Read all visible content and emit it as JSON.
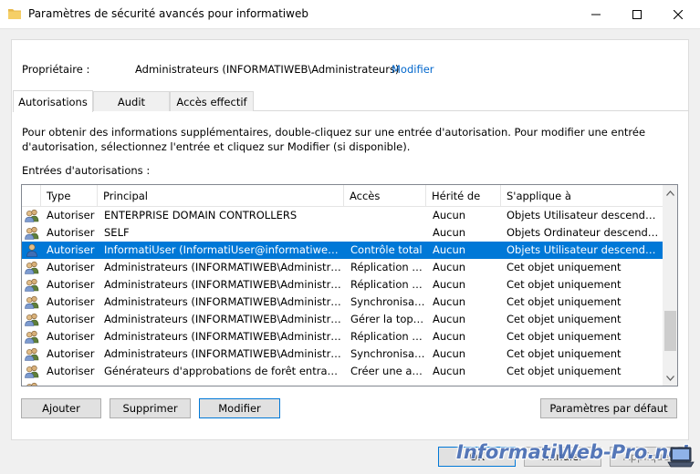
{
  "window": {
    "title": "Paramètres de sécurité avancés pour informatiweb",
    "icon": "folder-icon",
    "controls": [
      "minimize-icon",
      "maximize-icon",
      "close-icon"
    ]
  },
  "owner": {
    "label": "Propriétaire :",
    "value": "Administrateurs (INFORMATIWEB\\Administrateurs)",
    "change_link": "Modifier"
  },
  "tabs": [
    {
      "label": "Autorisations",
      "active": true
    },
    {
      "label": "Audit",
      "active": false
    },
    {
      "label": "Accès effectif",
      "active": false
    }
  ],
  "info_text": "Pour obtenir des informations supplémentaires, double-cliquez sur une entrée d'autorisation. Pour modifier une entrée d'autorisation, sélectionnez l'entrée et cliquez sur Modifier (si disponible).",
  "entries_label": "Entrées d'autorisations :",
  "table": {
    "columns": [
      "Type",
      "Principal",
      "Accès",
      "Hérité de",
      "S'applique à"
    ],
    "rows": [
      {
        "icon": "group-icon",
        "type": "Autoriser",
        "principal": "ENTERPRISE DOMAIN CONTROLLERS",
        "access": "",
        "inherited": "Aucun",
        "applies": "Objets Utilisateur descendants",
        "selected": false
      },
      {
        "icon": "group-icon",
        "type": "Autoriser",
        "principal": "SELF",
        "access": "",
        "inherited": "Aucun",
        "applies": "Objets Ordinateur descendants",
        "selected": false
      },
      {
        "icon": "user-icon",
        "type": "Autoriser",
        "principal": "InformatiUser (InformatiUser@informatiweb.lan)",
        "access": "Contrôle total",
        "inherited": "Aucun",
        "applies": "Objets Utilisateur descendants",
        "selected": true
      },
      {
        "icon": "group-icon",
        "type": "Autoriser",
        "principal": "Administrateurs (INFORMATIWEB\\Administrat...",
        "access": "Réplication d...",
        "inherited": "Aucun",
        "applies": "Cet objet uniquement",
        "selected": false
      },
      {
        "icon": "group-icon",
        "type": "Autoriser",
        "principal": "Administrateurs (INFORMATIWEB\\Administrat...",
        "access": "Réplication d...",
        "inherited": "Aucun",
        "applies": "Cet objet uniquement",
        "selected": false
      },
      {
        "icon": "group-icon",
        "type": "Autoriser",
        "principal": "Administrateurs (INFORMATIWEB\\Administrat...",
        "access": "Synchronisat...",
        "inherited": "Aucun",
        "applies": "Cet objet uniquement",
        "selected": false
      },
      {
        "icon": "group-icon",
        "type": "Autoriser",
        "principal": "Administrateurs (INFORMATIWEB\\Administrat...",
        "access": "Gérer la topo...",
        "inherited": "Aucun",
        "applies": "Cet objet uniquement",
        "selected": false
      },
      {
        "icon": "group-icon",
        "type": "Autoriser",
        "principal": "Administrateurs (INFORMATIWEB\\Administrat...",
        "access": "Réplication d...",
        "inherited": "Aucun",
        "applies": "Cet objet uniquement",
        "selected": false
      },
      {
        "icon": "group-icon",
        "type": "Autoriser",
        "principal": "Administrateurs (INFORMATIWEB\\Administrat...",
        "access": "Synchronisat...",
        "inherited": "Aucun",
        "applies": "Cet objet uniquement",
        "selected": false
      },
      {
        "icon": "group-icon",
        "type": "Autoriser",
        "principal": "Générateurs d'approbations de forêt entrante (I...",
        "access": "Créer une app...",
        "inherited": "Aucun",
        "applies": "Cet objet uniquement",
        "selected": false
      }
    ]
  },
  "buttons": {
    "add": "Ajouter",
    "remove": "Supprimer",
    "modify": "Modifier",
    "defaults": "Paramètres par défaut"
  },
  "dialog_buttons": {
    "ok": "OK",
    "cancel": "Annuler",
    "apply": "Appliquer"
  },
  "watermark": "InformatiWeb-Pro.net",
  "colors": {
    "selection": "#0078d7",
    "link": "#0066cc",
    "watermark": "#4a6fb5"
  }
}
